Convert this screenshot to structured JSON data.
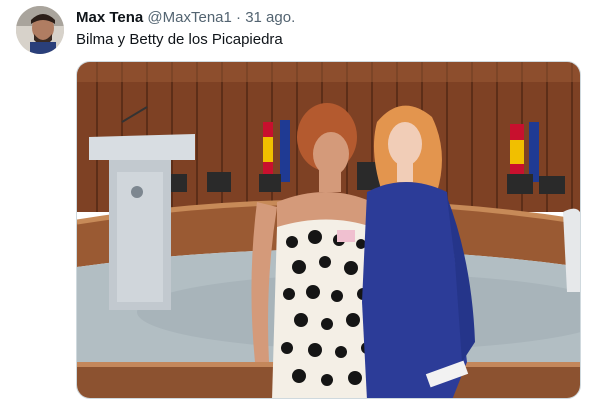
{
  "tweet": {
    "author_name": "Max Tena",
    "author_handle": "@MaxTena1",
    "separator": "·",
    "timestamp": "31 ago.",
    "text": "Bilma y Betty de los Picapiedra",
    "media_icon": "photo"
  },
  "colors": {
    "text_primary": "#0f1419",
    "text_secondary": "#536471",
    "wood_wall": "#8a4a28",
    "floor": "#b8c4c9",
    "dress_blue": "#2c3c98"
  }
}
